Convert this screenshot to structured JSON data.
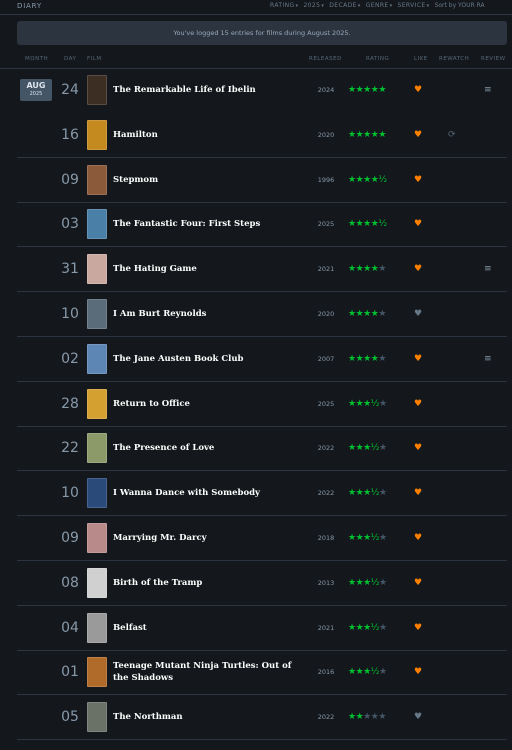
{
  "header": {
    "title": "DIARY",
    "filters": [
      "RATING",
      "2025",
      "DECADE",
      "GENRE",
      "SERVICE"
    ],
    "sort_label": "Sort by YOUR RA"
  },
  "banner": "You've logged 15 entries for films during August 2025.",
  "columns": {
    "month": "MONTH",
    "day": "DAY",
    "film": "FILM",
    "released": "RELEASED",
    "rating": "RATING",
    "like": "LIKE",
    "rewatch": "REWATCH",
    "review": "REVIEW"
  },
  "month_badge": {
    "month": "AUG",
    "year": "2025"
  },
  "colors": {
    "star_on": "#00c030",
    "star_off": "#445566",
    "liked": "#ff8000",
    "not_liked": "#667788"
  },
  "entries": [
    {
      "day": "24",
      "title": "The Remarkable Life of Ibelin",
      "year": "2024",
      "rating": 5,
      "liked": true,
      "rewatch": false,
      "review": true,
      "poster": "#3d2e24"
    },
    {
      "day": "16",
      "title": "Hamilton",
      "year": "2020",
      "rating": 5,
      "liked": true,
      "rewatch": true,
      "review": false,
      "poster": "#c58a1f"
    },
    {
      "day": "09",
      "title": "Stepmom",
      "year": "1996",
      "rating": 4.5,
      "liked": true,
      "rewatch": false,
      "review": false,
      "poster": "#8a5a3a"
    },
    {
      "day": "03",
      "title": "The Fantastic Four: First Steps",
      "year": "2025",
      "rating": 4.5,
      "liked": true,
      "rewatch": false,
      "review": false,
      "poster": "#4a7fa8"
    },
    {
      "day": "31",
      "title": "The Hating Game",
      "year": "2021",
      "rating": 4,
      "liked": true,
      "rewatch": false,
      "review": true,
      "poster": "#c9a8a0"
    },
    {
      "day": "10",
      "title": "I Am Burt Reynolds",
      "year": "2020",
      "rating": 4,
      "liked": false,
      "rewatch": false,
      "review": false,
      "poster": "#5a6c7a"
    },
    {
      "day": "02",
      "title": "The Jane Austen Book Club",
      "year": "2007",
      "rating": 4,
      "liked": true,
      "rewatch": false,
      "review": true,
      "poster": "#5e86b4"
    },
    {
      "day": "28",
      "title": "Return to Office",
      "year": "2025",
      "rating": 3.5,
      "liked": true,
      "rewatch": false,
      "review": false,
      "poster": "#d4a030"
    },
    {
      "day": "22",
      "title": "The Presence of Love",
      "year": "2022",
      "rating": 3.5,
      "liked": true,
      "rewatch": false,
      "review": false,
      "poster": "#8c9a6a"
    },
    {
      "day": "10",
      "title": "I Wanna Dance with Somebody",
      "year": "2022",
      "rating": 3.5,
      "liked": true,
      "rewatch": false,
      "review": false,
      "poster": "#2a4a7a"
    },
    {
      "day": "09",
      "title": "Marrying Mr. Darcy",
      "year": "2018",
      "rating": 3.5,
      "liked": true,
      "rewatch": false,
      "review": false,
      "poster": "#b88a8a"
    },
    {
      "day": "08",
      "title": "Birth of the Tramp",
      "year": "2013",
      "rating": 3.5,
      "liked": true,
      "rewatch": false,
      "review": false,
      "poster": "#d0d0d0"
    },
    {
      "day": "04",
      "title": "Belfast",
      "year": "2021",
      "rating": 3.5,
      "liked": true,
      "rewatch": false,
      "review": false,
      "poster": "#9a9a9a"
    },
    {
      "day": "01",
      "title": "Teenage Mutant Ninja Turtles: Out of the Shadows",
      "year": "2016",
      "rating": 3.5,
      "liked": true,
      "rewatch": false,
      "review": false,
      "poster": "#b06a2a"
    },
    {
      "day": "05",
      "title": "The Northman",
      "year": "2022",
      "rating": 2,
      "liked": false,
      "rewatch": false,
      "review": false,
      "poster": "#6a7268"
    }
  ]
}
